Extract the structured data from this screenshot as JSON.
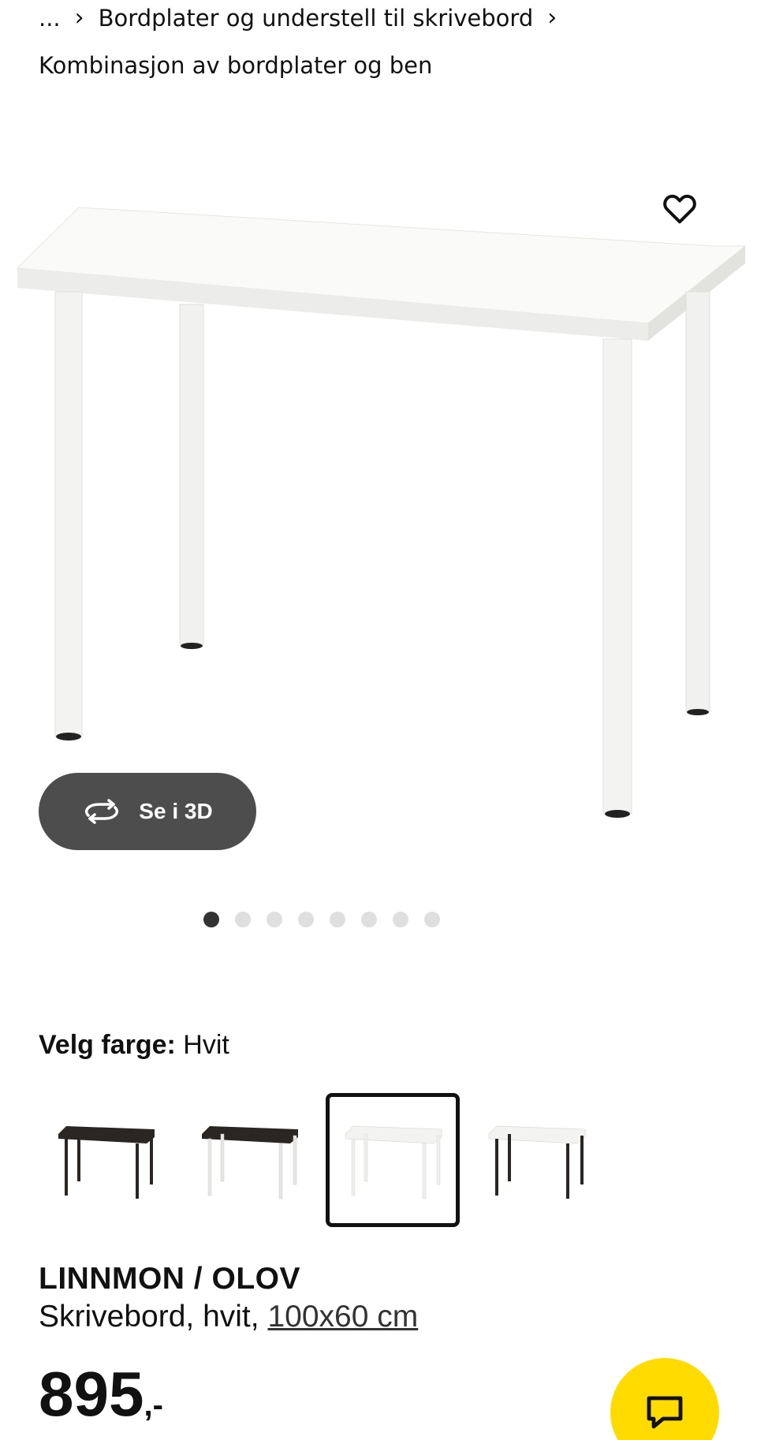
{
  "breadcrumb": {
    "ellipsis": "...",
    "items": [
      {
        "label": "Bordplater og understell til skrivebord"
      }
    ],
    "current": "Kombinasjon av bordplater og ben"
  },
  "gallery": {
    "view3d_label": "Se i 3D",
    "total_images": 8,
    "active_index": 0
  },
  "color_picker": {
    "label": "Velg farge:",
    "selected_value": "Hvit",
    "options": [
      {
        "name": "black-top-black-legs"
      },
      {
        "name": "black-top-white-legs"
      },
      {
        "name": "white-top-white-legs"
      },
      {
        "name": "white-top-black-legs"
      }
    ],
    "selected_index": 2
  },
  "product": {
    "name": "LINNMON / OLOV",
    "description": "Skrivebord, hvit,",
    "dimensions": "100x60 cm",
    "price": "895",
    "price_suffix": ",-"
  },
  "icons": {
    "favorite": "heart-icon",
    "rotate": "rotate-3d-icon",
    "chat": "chat-bubble-icon"
  },
  "colors": {
    "accent_yellow": "#ffdb00",
    "button_dark": "#4d4d4d",
    "dot_active": "#333333",
    "dot_inactive": "#dfdfdf"
  }
}
